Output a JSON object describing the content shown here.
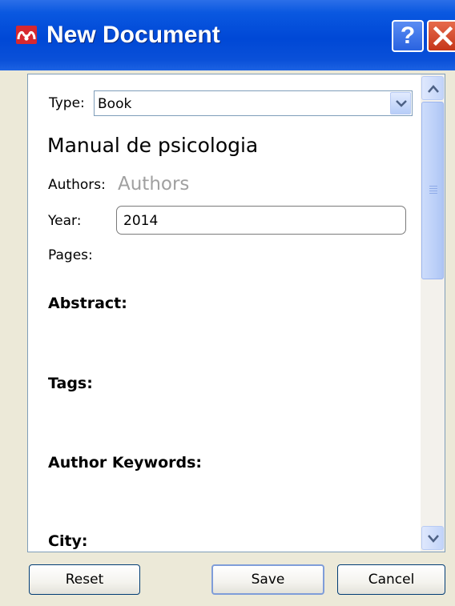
{
  "window": {
    "title": "New Document",
    "help_glyph": "?"
  },
  "form": {
    "type_label": "Type:",
    "type_value": "Book",
    "document_title": "Manual de psicologia",
    "authors_label": "Authors:",
    "authors_placeholder": "Authors",
    "year_label": "Year:",
    "year_value": "2014",
    "pages_label": "Pages:",
    "sections": {
      "abstract": "Abstract:",
      "tags": "Tags:",
      "author_keywords": "Author Keywords:",
      "city": "City:"
    }
  },
  "buttons": {
    "reset": "Reset",
    "save": "Save",
    "cancel": "Cancel"
  },
  "icons": {
    "app_logo": "mendeley-logo-icon",
    "help": "help-icon",
    "close": "close-icon",
    "dropdown": "chevron-down-icon",
    "scroll_up": "chevron-up-icon",
    "scroll_down": "chevron-down-icon"
  },
  "colors": {
    "titlebar": "#0048d6",
    "close_button": "#c5361a",
    "logo": "#d7282f",
    "placeholder": "#a0a0a0"
  }
}
